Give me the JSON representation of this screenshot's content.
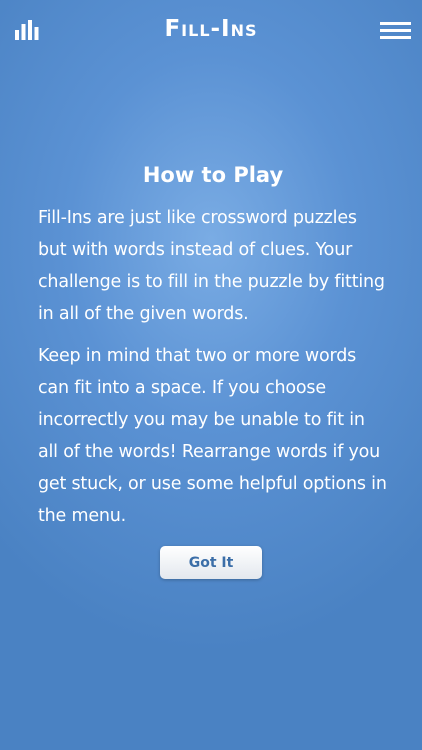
{
  "header": {
    "title": "Fill-Ins",
    "stats_icon": "bar-chart-icon",
    "menu_icon": "hamburger-menu-icon"
  },
  "dialog": {
    "title": "How to Play",
    "paragraphs": [
      "Fill-Ins are just like crossword puzzles but with words instead of clues. Your challenge is to fill in the puzzle by fitting in all of the given words.",
      "Keep in mind that two or more words can fit into a space. If you choose incorrectly you may be unable to fit in all of the words! Rearrange words if you get stuck, or use some helpful options in the menu."
    ],
    "button_label": "Got It"
  },
  "colors": {
    "background": "#5b92d4",
    "text": "#ffffff",
    "button_text": "#3b6ea8"
  }
}
